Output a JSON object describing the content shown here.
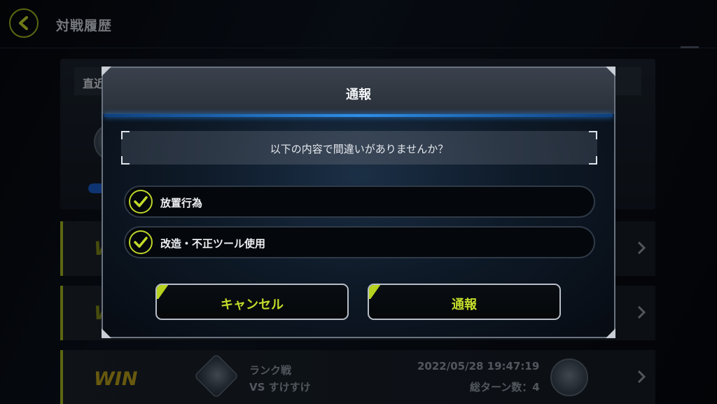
{
  "header": {
    "title": "対戦履歴",
    "back_label": ""
  },
  "background": {
    "recent_label": "直近",
    "rows": [
      {
        "result": "WIN"
      },
      {
        "result": "WIN"
      },
      {
        "result": "WIN",
        "mode": "ランク戦",
        "opponent": "VS すけすけ",
        "datetime": "2022/05/28 19:47:19",
        "turns": "総ターン数：4"
      }
    ]
  },
  "dialog": {
    "title": "通報",
    "message": "以下の内容で間違いがありませんか？",
    "options": [
      {
        "label": "放置行為",
        "checked": true
      },
      {
        "label": "改造・不正ツール使用",
        "checked": true
      }
    ],
    "cancel_label": "キャンセル",
    "confirm_label": "通報"
  },
  "colors": {
    "accent": "#b7d21e",
    "blue_line": "#2f8fe8",
    "win_text": "#b49a1b"
  }
}
